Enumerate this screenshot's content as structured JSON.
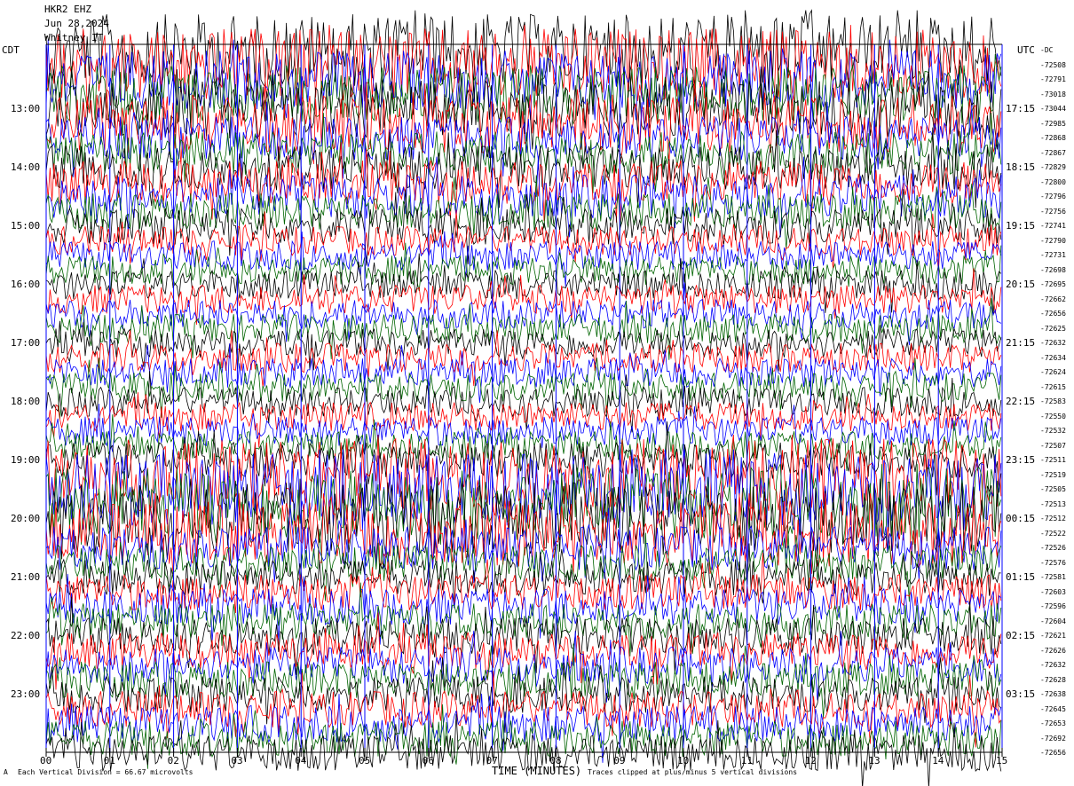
{
  "header": {
    "line1": "HKR2 EHZ",
    "line2": "Jun 28,2024",
    "line3": "Whitney IT"
  },
  "zones": {
    "left": "CDT",
    "right": "UTC"
  },
  "xaxis": {
    "title": "TIME (MINUTES)",
    "ticks": [
      "00",
      "01",
      "02",
      "03",
      "04",
      "05",
      "06",
      "07",
      "08",
      "09",
      "10",
      "11",
      "12",
      "13",
      "14",
      "15"
    ]
  },
  "footer": {
    "scale_note": "Each Vertical Division = 66.67 microvolts",
    "clip_note": "Traces clipped at plus/minus 5 vertical divisions",
    "mark": "A"
  },
  "colors": {
    "cycle": [
      "#000000",
      "#ff0000",
      "#0000ff",
      "#006400"
    ],
    "grid": "#0000ff",
    "background": "#ffffff"
  },
  "chart_data": {
    "type": "line",
    "title": "HKR2 EHZ Jun 28,2024 Whitney IT",
    "xlabel": "TIME (MINUTES)",
    "xlim": [
      0,
      15
    ],
    "rows_per_hour": 4,
    "minutes_per_row": 15,
    "left_hour_labels": [
      "13:00",
      "14:00",
      "15:00",
      "16:00",
      "17:00",
      "18:00",
      "19:00",
      "20:00",
      "21:00",
      "22:00",
      "23:00"
    ],
    "right_hour_labels": [
      "17:15",
      "18:15",
      "19:15",
      "20:15",
      "21:15",
      "22:15",
      "23:15",
      "00:15",
      "01:15",
      "02:15",
      "03:15"
    ],
    "row_offset_labels": [
      "-DC",
      "-72508",
      "-72791",
      "-73018",
      "-73044",
      "-72985",
      "-72868",
      "-72867",
      "-72829",
      "-72800",
      "-72796",
      "-72756",
      "-72741",
      "-72790",
      "-72731",
      "-72698",
      "-72695",
      "-72662",
      "-72656",
      "-72625",
      "-72632",
      "-72634",
      "-72624",
      "-72615",
      "-72583",
      "-72550",
      "-72532",
      "-72507",
      "-72511",
      "-72519",
      "-72505",
      "-72513",
      "-72512",
      "-72522",
      "-72526",
      "-72576",
      "-72581",
      "-72603",
      "-72596",
      "-72604",
      "-72621",
      "-72626",
      "-72632",
      "-72628",
      "-72638",
      "-72645",
      "-72653",
      "-72692",
      "-72656"
    ],
    "row_activity": [
      5,
      5,
      4,
      4,
      4,
      4,
      3,
      3,
      3,
      3,
      3,
      2.5,
      2.5,
      2,
      2,
      2,
      2,
      2,
      2,
      2,
      2,
      2,
      2,
      2,
      2,
      2,
      2,
      2,
      2.5,
      5,
      5,
      5,
      5,
      4.5,
      3,
      2.5,
      2.5,
      2.5,
      2.5,
      2.5,
      2.5,
      2.5,
      2.5,
      2.5,
      2.5,
      2.5,
      2.5,
      2.5,
      2.5
    ],
    "clip_divisions": 5,
    "microvolts_per_division": 66.67
  }
}
